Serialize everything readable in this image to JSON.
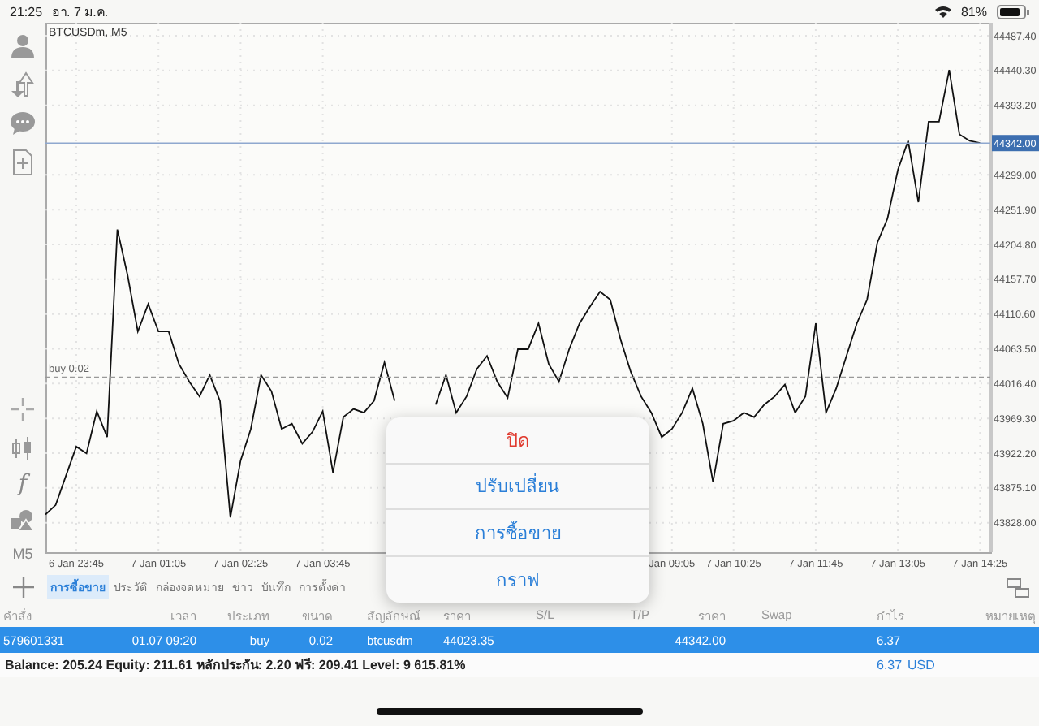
{
  "status_bar": {
    "time": "21:25",
    "date": "อา. 7 ม.ค.",
    "battery": "81%"
  },
  "toolbar": {
    "function_label": "f",
    "timeframe": "M5"
  },
  "chart": {
    "chart_data": {
      "type": "line",
      "title": "BTCUSDm, M5",
      "ylim": [
        43788,
        44505
      ],
      "grid": true,
      "categories": [
        null,
        null,
        null,
        "6 Jan 23:45",
        null,
        null,
        null,
        null,
        null,
        null,
        null,
        "7 Jan 01:05",
        null,
        null,
        null,
        null,
        null,
        null,
        null,
        "7 Jan 02:25",
        null,
        null,
        null,
        null,
        null,
        null,
        null,
        "7 Jan 03:45",
        null,
        null,
        null,
        null,
        null,
        null,
        null,
        null,
        null,
        null,
        null,
        null,
        null,
        null,
        null,
        null,
        null,
        null,
        null,
        null,
        null,
        null,
        null,
        null,
        null,
        null,
        null,
        null,
        null,
        null,
        null,
        null,
        null,
        "Jan 09:05",
        null,
        null,
        null,
        null,
        null,
        "7 Jan 10:25",
        null,
        null,
        null,
        null,
        null,
        null,
        null,
        "7 Jan 11:45",
        null,
        null,
        null,
        null,
        null,
        null,
        null,
        "7 Jan 13:05",
        null,
        null,
        null,
        null,
        null,
        null,
        null,
        "7 Jan 14:25"
      ],
      "series": [
        {
          "color": "#111111",
          "values": [
            43839,
            43852,
            43892,
            43931,
            43922,
            43979,
            43944,
            44225,
            44163,
            44087,
            44124,
            44087,
            44087,
            44043,
            44019,
            43999,
            44028,
            43993,
            43835,
            43912,
            43955,
            44028,
            44006,
            43955,
            43962,
            43935,
            43951,
            43979,
            43896,
            43971,
            43982,
            43977,
            43993,
            44045,
            43993,
            null,
            null,
            null,
            43988,
            44028,
            43977,
            43999,
            44036,
            44054,
            44019,
            43997,
            44063,
            44063,
            44098,
            44043,
            44019,
            44063,
            44098,
            44120,
            44141,
            44130,
            44076,
            44032,
            43999,
            43977,
            43944,
            43955,
            43977,
            44010,
            43962,
            43883,
            43962,
            43966,
            43977,
            43971,
            43988,
            43999,
            44015,
            43977,
            43999,
            44098,
            43977,
            44010,
            44054,
            44098,
            44130,
            44207,
            44240,
            44306,
            44345,
            44262,
            44371,
            44371,
            44441,
            44354,
            44345,
            44342
          ]
        }
      ],
      "yticks": [
        {
          "value": 44487.4,
          "label": "44487.40"
        },
        {
          "value": 44440.3,
          "label": "44440.30"
        },
        {
          "value": 44393.2,
          "label": "44393.20"
        },
        {
          "value": 44299,
          "label": "44299.00"
        },
        {
          "value": 44251.9,
          "label": "44251.90"
        },
        {
          "value": 44204.8,
          "label": "44204.80"
        },
        {
          "value": 44157.7,
          "label": "44157.70"
        },
        {
          "value": 44110.6,
          "label": "44110.60"
        },
        {
          "value": 44063.5,
          "label": "44063.50"
        },
        {
          "value": 44016.4,
          "label": "44016.40"
        },
        {
          "value": 43969.3,
          "label": "43969.30"
        },
        {
          "value": 43922.2,
          "label": "43922.20"
        },
        {
          "value": 43875.1,
          "label": "43875.10"
        },
        {
          "value": 43828,
          "label": "43828.00"
        }
      ],
      "ref_lines": [
        {
          "axis": "y",
          "value": 44342,
          "label": "44342.00"
        },
        {
          "axis": "y",
          "value": 44025,
          "label": "buy 0.02"
        }
      ]
    }
  },
  "tabs": [
    {
      "label": "การซื้อขาย",
      "selected": true
    },
    {
      "label": "ประวัติ",
      "selected": false
    },
    {
      "label": "กล่องจดหมาย",
      "selected": false
    },
    {
      "label": "ข่าว",
      "selected": false
    },
    {
      "label": "บันทึก",
      "selected": false
    },
    {
      "label": "การตั้งค่า",
      "selected": false
    }
  ],
  "table": {
    "columns": [
      "คำสั่ง",
      "เวลา",
      "ประเภท",
      "ขนาด",
      "สัญลักษณ์",
      "ราคา",
      "S/L",
      "T/P",
      "ราคา",
      "Swap",
      "กำไร",
      "หมายเหตุ"
    ],
    "rows": [
      {
        "selected": true,
        "cells": [
          "579601331",
          "01.07 09:20",
          "buy",
          "0.02",
          "btcusdm",
          "44023.35",
          "",
          "",
          "44342.00",
          "",
          "6.37",
          ""
        ]
      }
    ],
    "summary": {
      "text": "Balance: 205.24 Equity: 211.61 หลักประกัน: 2.20 ฟรี: 209.41 Level: 9 615.81%",
      "profit": "6.37",
      "currency": "USD"
    }
  },
  "action_sheet": {
    "items": [
      {
        "label": "ปิด",
        "kind": "destructive"
      },
      {
        "label": "ปรับเปลี่ยน",
        "kind": "default"
      },
      {
        "label": "การซื้อขาย",
        "kind": "default"
      },
      {
        "label": "กราฟ",
        "kind": "default"
      }
    ]
  }
}
